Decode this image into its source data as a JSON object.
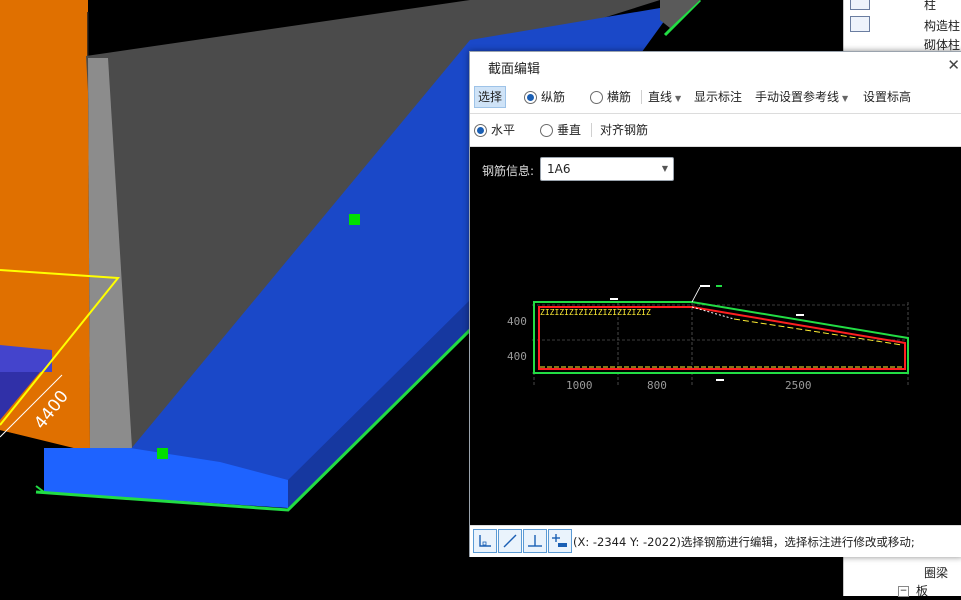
{
  "viewport": {
    "dimension_label": "4400"
  },
  "right_panel": {
    "items": [
      {
        "label": "柱"
      },
      {
        "label": "构造柱"
      },
      {
        "label": "砌体柱"
      },
      {
        "label": "圈梁"
      },
      {
        "label": "板"
      }
    ]
  },
  "dialog": {
    "title": "截面编辑",
    "close_icon": "close-icon",
    "toolbar1": {
      "select": "选择",
      "longitudinal": "纵筋",
      "transverse": "横筋",
      "line": "直线",
      "show_dims": "显示标注",
      "manual_ref": "手动设置参考线",
      "set_elev": "设置标高"
    },
    "toolbar2": {
      "horizontal": "水平",
      "vertical": "垂直",
      "align": "对齐钢筋"
    },
    "rebar_info": {
      "label": "钢筋信息:",
      "value": "1A6"
    },
    "section_dims": {
      "left_top": "400",
      "left_bottom": "400",
      "bottom": [
        "1000",
        "800",
        "2500"
      ]
    },
    "status": {
      "text": "(X: -2344 Y: -2022)选择钢筋进行编辑，选择标注进行修改或移动;"
    }
  },
  "colors": {
    "orange": "#e07000",
    "dark_gray": "#4d4d4d",
    "blue": "#1b4fd1",
    "green_marker": "#00e000",
    "rebar_red": "#ff2020",
    "accent": "#5b9bd5"
  }
}
